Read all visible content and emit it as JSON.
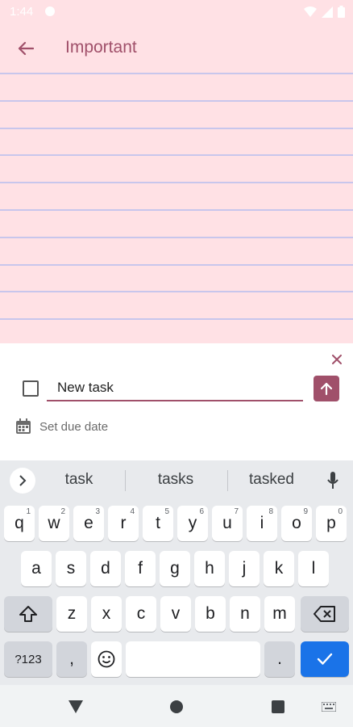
{
  "status": {
    "time": "1:44"
  },
  "app_bar": {
    "title": "Important"
  },
  "sheet": {
    "input_value": "New task",
    "due_date_label": "Set due date"
  },
  "keyboard": {
    "suggestions": [
      "task",
      "tasks",
      "tasked"
    ],
    "row1": [
      {
        "k": "q",
        "h": "1"
      },
      {
        "k": "w",
        "h": "2"
      },
      {
        "k": "e",
        "h": "3"
      },
      {
        "k": "r",
        "h": "4"
      },
      {
        "k": "t",
        "h": "5"
      },
      {
        "k": "y",
        "h": "6"
      },
      {
        "k": "u",
        "h": "7"
      },
      {
        "k": "i",
        "h": "8"
      },
      {
        "k": "o",
        "h": "9"
      },
      {
        "k": "p",
        "h": "0"
      }
    ],
    "row2": [
      "a",
      "s",
      "d",
      "f",
      "g",
      "h",
      "j",
      "k",
      "l"
    ],
    "row3": [
      "z",
      "x",
      "c",
      "v",
      "b",
      "n",
      "m"
    ],
    "symbols_label": "?123",
    "comma_label": ",",
    "period_label": "."
  },
  "colors": {
    "accent": "#a0506a",
    "paper": "#ffe1e5",
    "rule_line": "#c8c6ec",
    "enter_key": "#1a73e8"
  },
  "icons": {
    "back": "arrow-left-icon",
    "close": "close-icon",
    "send": "arrow-up-icon",
    "calendar": "calendar-icon",
    "mic": "mic-icon",
    "expand": "chevron-right-icon",
    "shift": "shift-icon",
    "backspace": "backspace-icon",
    "emoji": "emoji-icon",
    "enter": "check-icon",
    "nav_back": "triangle-back-icon",
    "nav_home": "circle-home-icon",
    "nav_recents": "square-recents-icon"
  }
}
